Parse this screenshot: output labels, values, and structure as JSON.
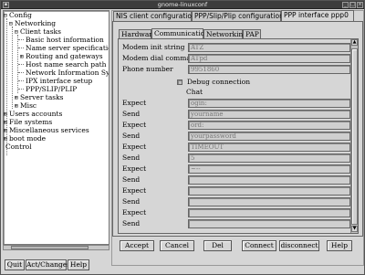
{
  "window": {
    "title": "gnome-linuxconf"
  },
  "tree": {
    "nodes": [
      {
        "label": "Config",
        "expander": "⊟"
      },
      {
        "label": "Networking",
        "expander": "⊟"
      },
      {
        "label": "Client tasks",
        "expander": "⊟"
      },
      {
        "label": "Basic host information",
        "expander": ""
      },
      {
        "label": "Name server specification (",
        "expander": ""
      },
      {
        "label": "Routing and gateways",
        "expander": "⊞"
      },
      {
        "label": "Host name search path",
        "expander": ""
      },
      {
        "label": "Network Information Syste",
        "expander": ""
      },
      {
        "label": "IPX interface setup",
        "expander": ""
      },
      {
        "label": "PPP/SLIP/PLIP",
        "expander": ""
      },
      {
        "label": "Server tasks",
        "expander": "⊞"
      },
      {
        "label": "Misc",
        "expander": "⊞"
      },
      {
        "label": "Users accounts",
        "expander": "⊞"
      },
      {
        "label": "File systems",
        "expander": "⊞"
      },
      {
        "label": "Miscellaneous services",
        "expander": "⊞"
      },
      {
        "label": "boot mode",
        "expander": "⊞"
      },
      {
        "label": "Control",
        "expander": "⊞"
      }
    ]
  },
  "left_buttons": {
    "quit": "Quit",
    "act_changes": "Act/Changes",
    "help": "Help"
  },
  "top_tabs": [
    {
      "label": "NIS client configuration"
    },
    {
      "label": "PPP/Slip/Plip configurations"
    },
    {
      "label": "PPP interface ppp0"
    }
  ],
  "sub_tabs": [
    {
      "label": "Hardware"
    },
    {
      "label": "Communication"
    },
    {
      "label": "Networking"
    },
    {
      "label": "PAP"
    }
  ],
  "form": {
    "modem_init": {
      "label": "Modem init string",
      "value": "ATZ"
    },
    "modem_dial": {
      "label": "Modem dial command",
      "value": "ATpd"
    },
    "phone": {
      "label": "Phone number",
      "value": "9951860"
    },
    "debug": {
      "label": "Debug connection"
    },
    "chat_heading": "Chat",
    "chat": [
      {
        "label": "Expect",
        "value": "ogin:"
      },
      {
        "label": "Send",
        "value": "yourname"
      },
      {
        "label": "Expect",
        "value": "ord:"
      },
      {
        "label": "Send",
        "value": "yourpassword"
      },
      {
        "label": "Expect",
        "value": "TIMEOUT"
      },
      {
        "label": "Send",
        "value": "5"
      },
      {
        "label": "Expect",
        "value": "~--"
      },
      {
        "label": "Send",
        "value": ""
      },
      {
        "label": "Expect",
        "value": ""
      },
      {
        "label": "Send",
        "value": ""
      },
      {
        "label": "Expect",
        "value": ""
      },
      {
        "label": "Send",
        "value": ""
      }
    ]
  },
  "bottom_buttons": {
    "accept": "Accept",
    "cancel": "Cancel",
    "del": "Del",
    "connect": "Connect",
    "disconnect": "disconnect",
    "help": "Help"
  },
  "icons": {
    "minimize": "minimize-icon",
    "maximize": "maximize-icon",
    "close": "close-icon"
  }
}
